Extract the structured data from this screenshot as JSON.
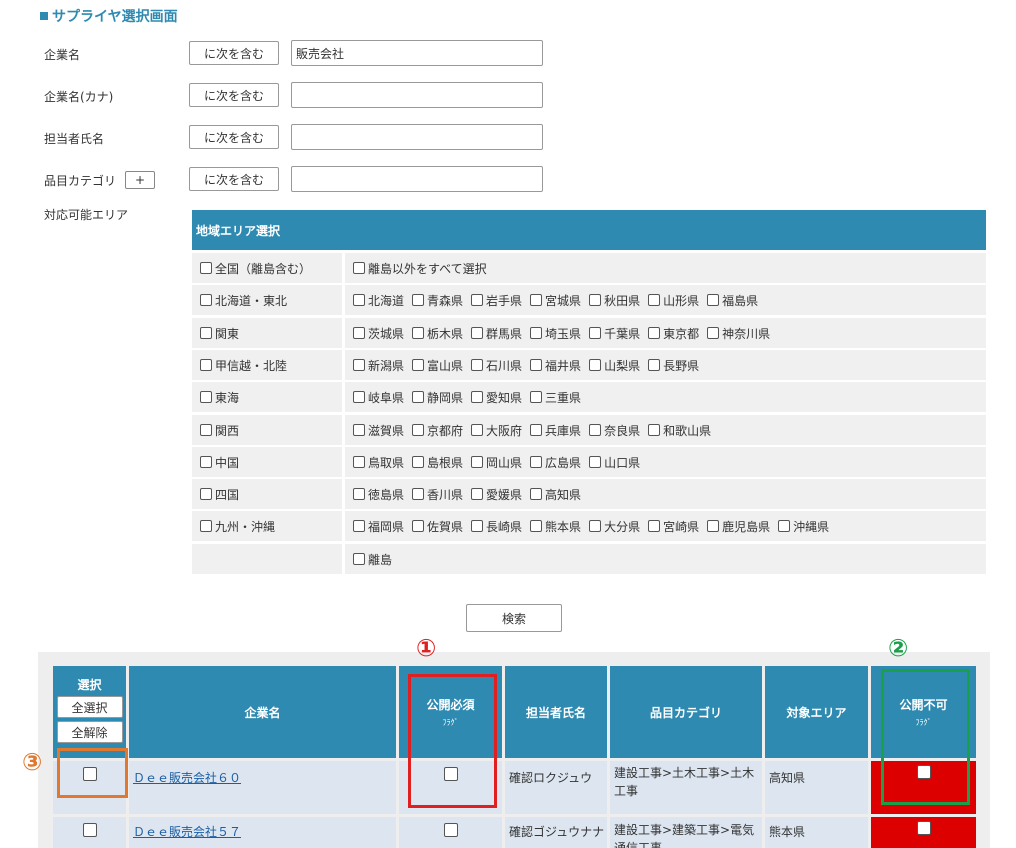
{
  "title": "サプライヤ選択画面",
  "filters": [
    {
      "label": "企業名",
      "op": "に次を含む",
      "value": "販売会社"
    },
    {
      "label": "企業名(カナ)",
      "op": "に次を含む",
      "value": ""
    },
    {
      "label": "担当者氏名",
      "op": "に次を含む",
      "value": ""
    },
    {
      "label": "品目カテゴリ",
      "op": "に次を含む",
      "value": "",
      "plus": "+"
    }
  ],
  "area_label": "対応可能エリア",
  "area_header": "地域エリア選択",
  "areas": [
    {
      "region": "全国（離島含む）",
      "items": [
        "離島以外をすべて選択"
      ]
    },
    {
      "region": "北海道・東北",
      "items": [
        "北海道",
        "青森県",
        "岩手県",
        "宮城県",
        "秋田県",
        "山形県",
        "福島県"
      ]
    },
    {
      "region": "関東",
      "items": [
        "茨城県",
        "栃木県",
        "群馬県",
        "埼玉県",
        "千葉県",
        "東京都",
        "神奈川県"
      ]
    },
    {
      "region": "甲信越・北陸",
      "items": [
        "新潟県",
        "富山県",
        "石川県",
        "福井県",
        "山梨県",
        "長野県"
      ]
    },
    {
      "region": "東海",
      "items": [
        "岐阜県",
        "静岡県",
        "愛知県",
        "三重県"
      ]
    },
    {
      "region": "関西",
      "items": [
        "滋賀県",
        "京都府",
        "大阪府",
        "兵庫県",
        "奈良県",
        "和歌山県"
      ]
    },
    {
      "region": "中国",
      "items": [
        "鳥取県",
        "島根県",
        "岡山県",
        "広島県",
        "山口県"
      ]
    },
    {
      "region": "四国",
      "items": [
        "徳島県",
        "香川県",
        "愛媛県",
        "高知県"
      ]
    },
    {
      "region": "九州・沖縄",
      "items": [
        "福岡県",
        "佐賀県",
        "長崎県",
        "熊本県",
        "大分県",
        "宮崎県",
        "鹿児島県",
        "沖縄県"
      ]
    },
    {
      "region": "",
      "items": [
        "離島"
      ]
    }
  ],
  "search_label": "検索",
  "table": {
    "select_header": "選択",
    "select_all": "全選択",
    "deselect_all": "全解除",
    "col_company": "企業名",
    "col_public_required": "公開必須",
    "col_public_required_sub": "ﾌﾗｸﾞ",
    "col_contact": "担当者氏名",
    "col_category": "品目カテゴリ",
    "col_area": "対象エリア",
    "col_public_forbidden": "公開不可",
    "col_public_forbidden_sub": "ﾌﾗｸﾞ",
    "rows": [
      {
        "company": "Ｄｅｅ販売会社６０",
        "contact": "確認ロクジュウ",
        "category": "建設工事>土木工事>土木工事",
        "area": "高知県"
      },
      {
        "company": "Ｄｅｅ販売会社５７",
        "contact": "確認ゴジュウナナ",
        "category": "建設工事>建築工事>電気通信工事",
        "area": "熊本県"
      }
    ]
  },
  "markers": {
    "m1": "①",
    "m2": "②",
    "m3": "③"
  },
  "colors": {
    "accent": "#2e8ab0",
    "red_mark": "#e02020",
    "green_mark": "#1aa04a",
    "orange_mark": "#e07830",
    "forbidden_cell": "#dd0000"
  }
}
